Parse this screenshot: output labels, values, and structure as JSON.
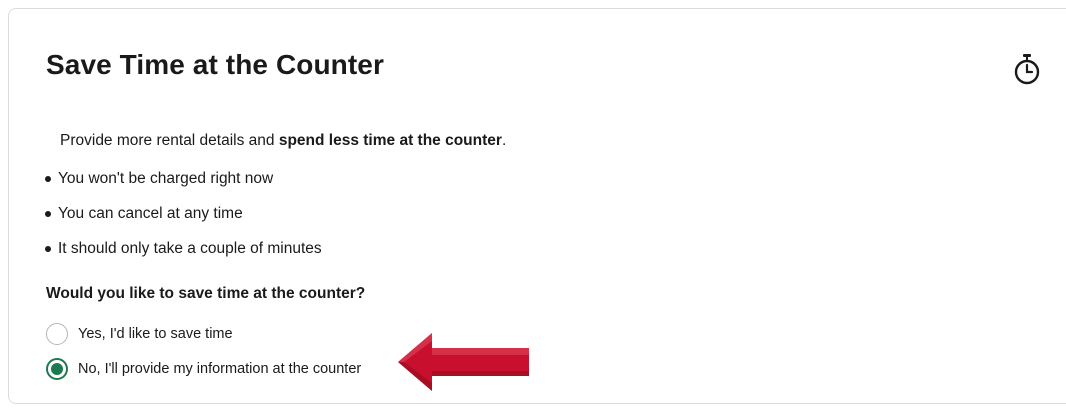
{
  "card": {
    "title": "Save Time at the Counter",
    "timer_icon": "stopwatch-icon",
    "intro_prefix": "Provide more rental details and ",
    "intro_bold": "spend less time at the counter",
    "intro_suffix": ".",
    "bullets": [
      "You won't be charged right now",
      "You can cancel at any time",
      "It should only take a couple of minutes"
    ],
    "question": "Would you like to save time at the counter?",
    "options": [
      {
        "label": "Yes, I'd like to save time",
        "selected": false
      },
      {
        "label": "No, I'll provide my information at the counter",
        "selected": true
      }
    ]
  },
  "colors": {
    "accent": "#1d7a4f",
    "annotation_arrow": "#c8102e"
  }
}
